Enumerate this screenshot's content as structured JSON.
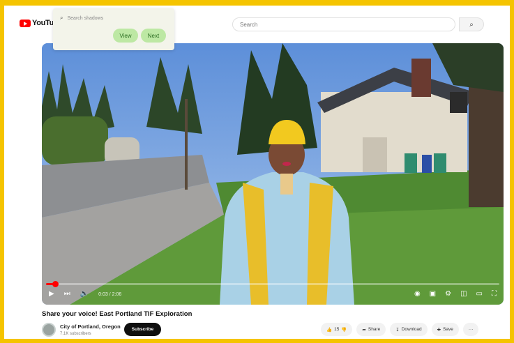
{
  "topbar": {
    "logo_word": "YouTube",
    "search_placeholder": "Search",
    "search_icon": "search-icon"
  },
  "popup": {
    "search_text": "Search shadows",
    "view_label": "View",
    "next_label": "Next"
  },
  "video": {
    "time": "0:03 / 2:06",
    "progress": 0.02
  },
  "meta": {
    "title": "Share your voice! East Portland TIF Exploration",
    "channel": "City of Portland, Oregon",
    "subscribers": "7.1K subscribers",
    "subscribe_label": "Subscribe",
    "like_count": "15",
    "share_label": "Share",
    "download_label": "Download",
    "save_label": "Save",
    "more_label": "···"
  },
  "colors": {
    "frame": "#f5c400",
    "brand_red": "#ff0000",
    "pill_green": "#bde8a4"
  }
}
